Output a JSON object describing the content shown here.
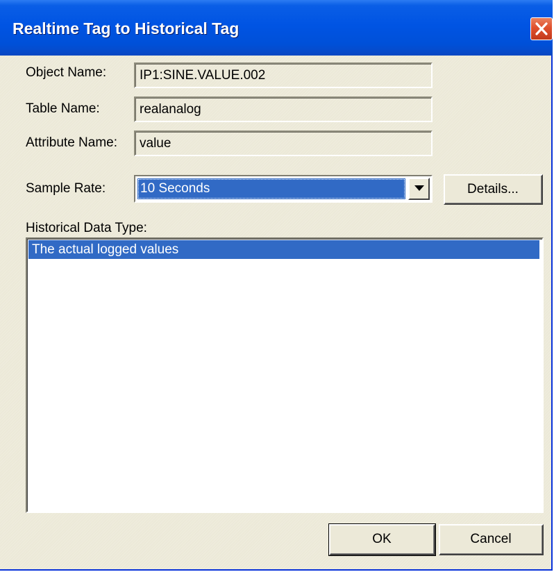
{
  "window": {
    "title": "Realtime Tag to Historical Tag"
  },
  "form": {
    "object_name_label": "Object Name:",
    "object_name_value": "IP1:SINE.VALUE.002",
    "table_name_label": "Table Name:",
    "table_name_value": "realanalog",
    "attribute_name_label": "Attribute Name:",
    "attribute_name_value": "value",
    "sample_rate_label": "Sample Rate:",
    "sample_rate_value": "10 Seconds",
    "details_label": "Details...",
    "historical_type_label": "Historical Data Type:",
    "historical_types": [
      "The actual logged values"
    ]
  },
  "buttons": {
    "ok_label": "OK",
    "cancel_label": "Cancel"
  },
  "icons": {
    "close": "close-icon",
    "dropdown": "chevron-down-icon"
  },
  "colors": {
    "title_bar": "#0054e3",
    "selection": "#316ac5",
    "dialog_face": "#ece9d8",
    "close_button": "#e0502d"
  }
}
